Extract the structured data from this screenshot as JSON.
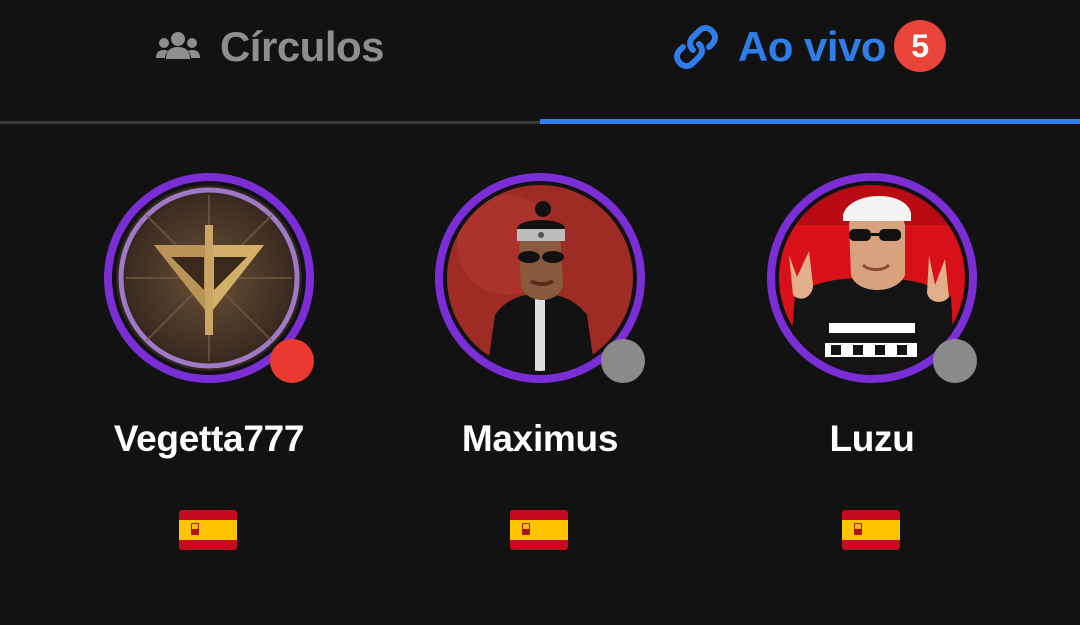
{
  "tabs": [
    {
      "label": "Círculos",
      "icon": "users-icon",
      "active": false
    },
    {
      "label": "Ao vivo",
      "icon": "link-icon",
      "active": true,
      "badge": "5"
    }
  ],
  "colors": {
    "background": "#121213",
    "active_tab": "#2f7de8",
    "inactive_tab": "#8e8e90",
    "badge": "#e9443a",
    "ring": "#7b2ed6",
    "live_dot": "#ea3a30",
    "offline_dot": "#8a8a8c"
  },
  "users": [
    {
      "name": "Vegetta777",
      "status": "live",
      "flag": "spain-flag"
    },
    {
      "name": "Maximus",
      "status": "offline",
      "flag": "spain-flag"
    },
    {
      "name": "Luzu",
      "status": "offline",
      "flag": "spain-flag"
    }
  ]
}
